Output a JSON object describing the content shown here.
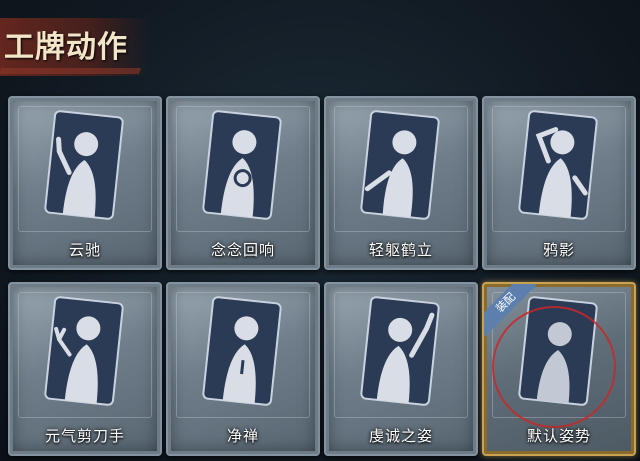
{
  "header": {
    "title": "工牌动作"
  },
  "cards": [
    {
      "label": "云驰",
      "pose": "hand-raised-left"
    },
    {
      "label": "念念回响",
      "pose": "hug"
    },
    {
      "label": "轻躯鹤立",
      "pose": "arms-wide"
    },
    {
      "label": "鸦影",
      "pose": "hand-on-head"
    },
    {
      "label": "元气剪刀手",
      "pose": "peace-sign"
    },
    {
      "label": "净禅",
      "pose": "prayer"
    },
    {
      "label": "虔诚之姿",
      "pose": "arm-up"
    },
    {
      "label": "默认姿势",
      "pose": "default",
      "badge": "装配"
    }
  ],
  "colors": {
    "card_frame": "#8593a0",
    "card_inner": "#2b3a55",
    "silhouette": "#d9dde6",
    "equipped_gold": "#c9a352",
    "badge_blue": "#5d7fae",
    "title_banner": "#6e281e"
  }
}
